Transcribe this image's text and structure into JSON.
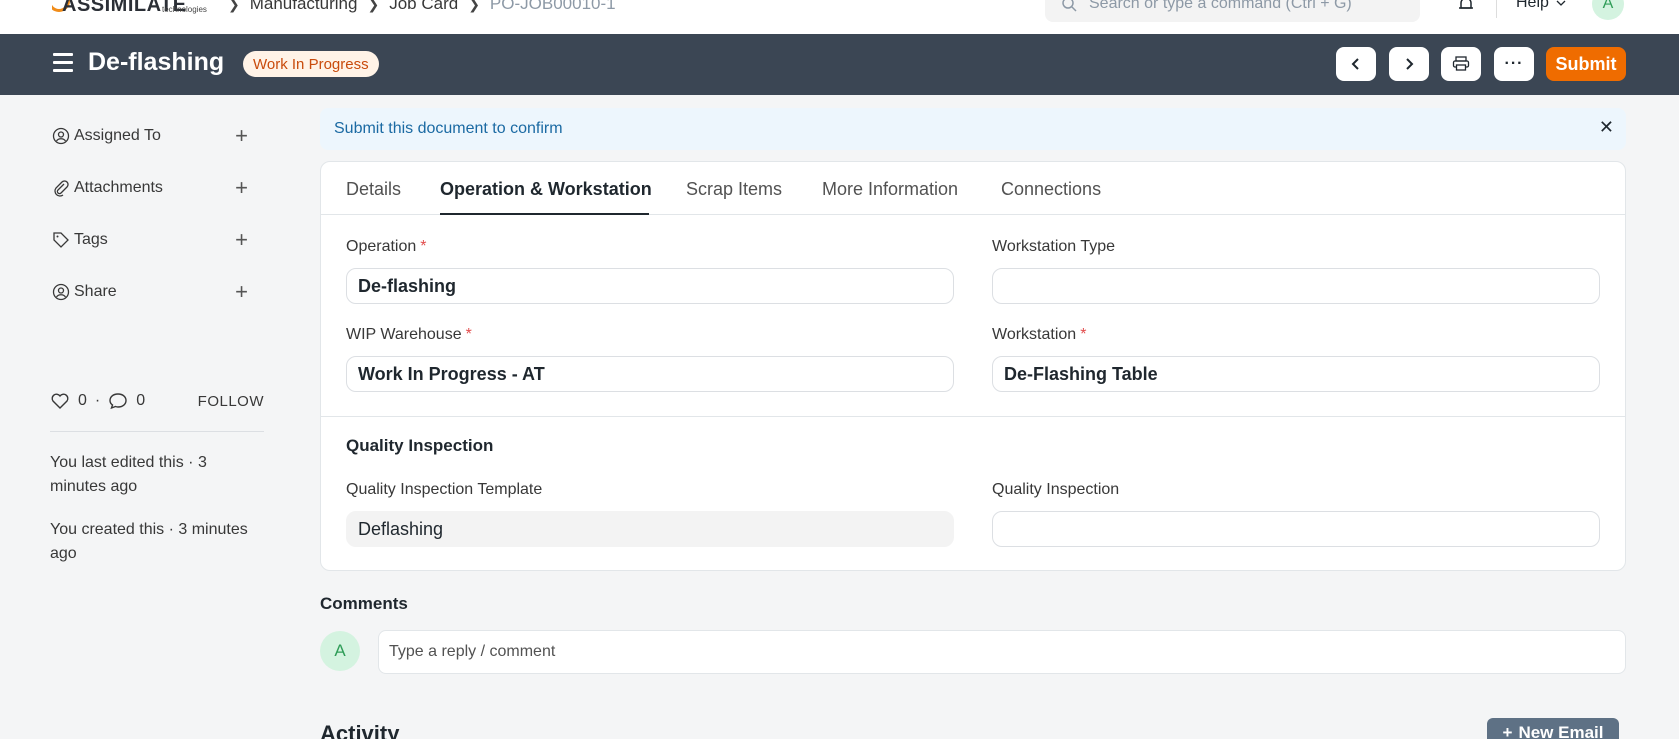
{
  "navbar": {
    "logo_text": "ASSIMILATE",
    "logo_sub": "technologies",
    "breadcrumbs": [
      "Manufacturing",
      "Job Card",
      "PO-JOB00010-1"
    ],
    "search_placeholder": "Search or type a command (Ctrl + G)",
    "help_label": "Help",
    "avatar_initial": "A"
  },
  "header": {
    "title": "De-flashing",
    "status": "Work In Progress",
    "submit_label": "Submit"
  },
  "sidebar": {
    "items": [
      {
        "label": "Assigned To"
      },
      {
        "label": "Attachments"
      },
      {
        "label": "Tags"
      },
      {
        "label": "Share"
      }
    ],
    "likes": "0",
    "comments_count": "0",
    "follow_label": "FOLLOW",
    "last_edited": "You last edited this · 3 minutes ago",
    "created": "You created this · 3 minutes ago"
  },
  "alert": {
    "message": "Submit this document to confirm"
  },
  "tabs": [
    {
      "label": "Details"
    },
    {
      "label": "Operation & Workstation"
    },
    {
      "label": "Scrap Items"
    },
    {
      "label": "More Information"
    },
    {
      "label": "Connections"
    }
  ],
  "form": {
    "operation": {
      "label": "Operation",
      "value": "De-flashing"
    },
    "workstation_type": {
      "label": "Workstation Type",
      "value": ""
    },
    "wip_warehouse": {
      "label": "WIP Warehouse",
      "value": "Work In Progress - AT"
    },
    "workstation": {
      "label": "Workstation",
      "value": "De-Flashing Table"
    },
    "quality_section_title": "Quality Inspection",
    "qi_template": {
      "label": "Quality Inspection Template",
      "value": "Deflashing"
    },
    "quality_inspection": {
      "label": "Quality Inspection",
      "value": ""
    }
  },
  "comments": {
    "title": "Comments",
    "avatar_initial": "A",
    "placeholder": "Type a reply / comment"
  },
  "activity": {
    "title": "Activity",
    "new_email_label": "New Email"
  },
  "colors": {
    "header_bg": "#3b4654",
    "submit": "#ef6c00",
    "status_text": "#c94b0c",
    "status_bg": "#fff3e7",
    "alert_bg": "#edf6fd",
    "alert_text": "#1b6aa3"
  }
}
